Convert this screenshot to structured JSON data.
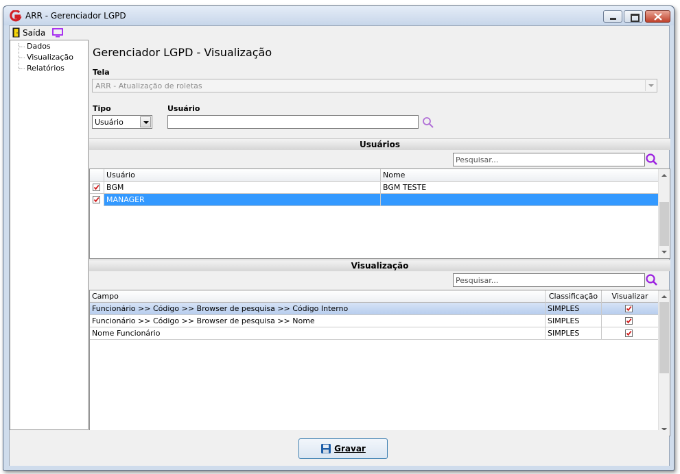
{
  "window": {
    "title": "ARR - Gerenciador LGPD"
  },
  "menu": {
    "exit_label": "Saída"
  },
  "tree": {
    "items": [
      "Dados",
      "Visualização",
      "Relatórios"
    ]
  },
  "main": {
    "title": "Gerenciador LGPD - Visualização",
    "tela_label": "Tela",
    "tela_value": "ARR - Atualização de roletas",
    "tipo_label": "Tipo",
    "tipo_value": "Usuário",
    "usuario_label": "Usuário",
    "usuario_value": ""
  },
  "users_section": {
    "title": "Usuários",
    "search_placeholder": "Pesquisar...",
    "columns": [
      "Usuário",
      "Nome"
    ],
    "rows": [
      {
        "checked": true,
        "usuario": "BGM",
        "nome": "BGM TESTE",
        "selected": false
      },
      {
        "checked": true,
        "usuario": "MANAGER",
        "nome": "",
        "selected": true
      }
    ]
  },
  "view_section": {
    "title": "Visualização",
    "search_placeholder": "Pesquisar...",
    "columns": [
      "Campo",
      "Classificação",
      "Visualizar"
    ],
    "rows": [
      {
        "campo": "Funcionário >> Código >> Browser de pesquisa >> Código Interno",
        "classificacao": "SIMPLES",
        "visualizar": true,
        "selected": true
      },
      {
        "campo": "Funcionário >> Código >> Browser de pesquisa >> Nome",
        "classificacao": "SIMPLES",
        "visualizar": true,
        "selected": false
      },
      {
        "campo": "Nome Funcionário",
        "classificacao": "SIMPLES",
        "visualizar": true,
        "selected": false
      }
    ]
  },
  "footer": {
    "save_label": "Gravar"
  },
  "colors": {
    "selection": "#3399ff",
    "selection_light": "#c5d7f2",
    "accent": "#a020f0"
  }
}
